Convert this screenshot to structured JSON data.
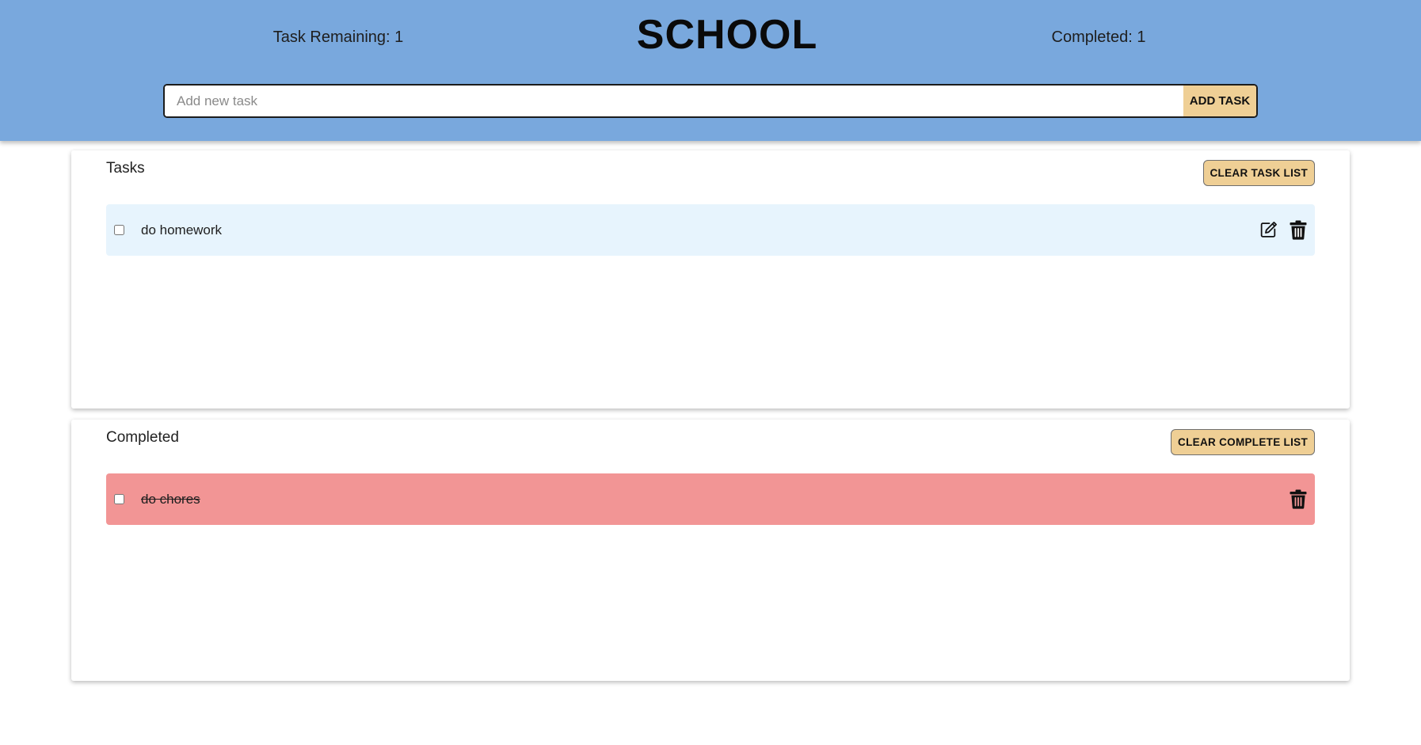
{
  "header": {
    "title": "SCHOOL",
    "remaining_text": "Task Remaining: 1",
    "completed_text": "Completed: 1",
    "add_placeholder": "Add new task",
    "add_value": "",
    "add_button_label": "ADD TASK"
  },
  "tasks_section": {
    "title": "Tasks",
    "clear_label": "CLEAR TASK LIST",
    "items": [
      {
        "text": "do homework",
        "checked": false,
        "icons": [
          "edit-icon",
          "trash-icon"
        ]
      }
    ]
  },
  "completed_section": {
    "title": "Completed",
    "clear_label": "CLEAR COMPLETE LIST",
    "items": [
      {
        "text": "do chores",
        "checked": false,
        "icons": [
          "trash-icon"
        ]
      }
    ]
  },
  "colors": {
    "header_bg": "#79a8dd",
    "button_bg": "#efcf95",
    "active_row_bg": "#e7f4fd",
    "completed_row_bg": "#f29595"
  }
}
